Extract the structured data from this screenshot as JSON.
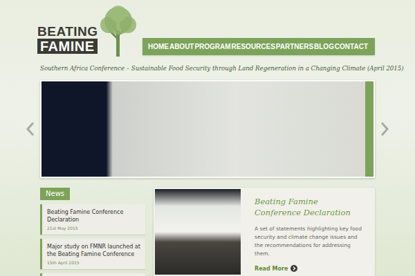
{
  "logo": {
    "line1": "BEATING",
    "line2": "FAMINE"
  },
  "nav": [
    {
      "label": "HOME"
    },
    {
      "label": "ABOUT"
    },
    {
      "label": "PROGRAM"
    },
    {
      "label": "RESOURCES"
    },
    {
      "label": "PARTNERS"
    },
    {
      "label": "BLOG"
    },
    {
      "label": "CONTACT"
    }
  ],
  "tagline": "Southern Africa Conference – Sustainable Food Security through Land Regeneration in a Changing Climate (April 2015)",
  "news": {
    "heading": "News",
    "items": [
      {
        "title": "Beating Famine Conference Declaration",
        "date": "21st May 2015"
      },
      {
        "title": "Major study on FMNR launched at the Beating Famine Conference",
        "date": "15th April 2015"
      }
    ]
  },
  "feature": {
    "title": "Beating Famine Conference Declaration",
    "description": "A set of statements highlighting key food security and climate change issues and the recommendations for addressing them.",
    "link": "Read More"
  }
}
